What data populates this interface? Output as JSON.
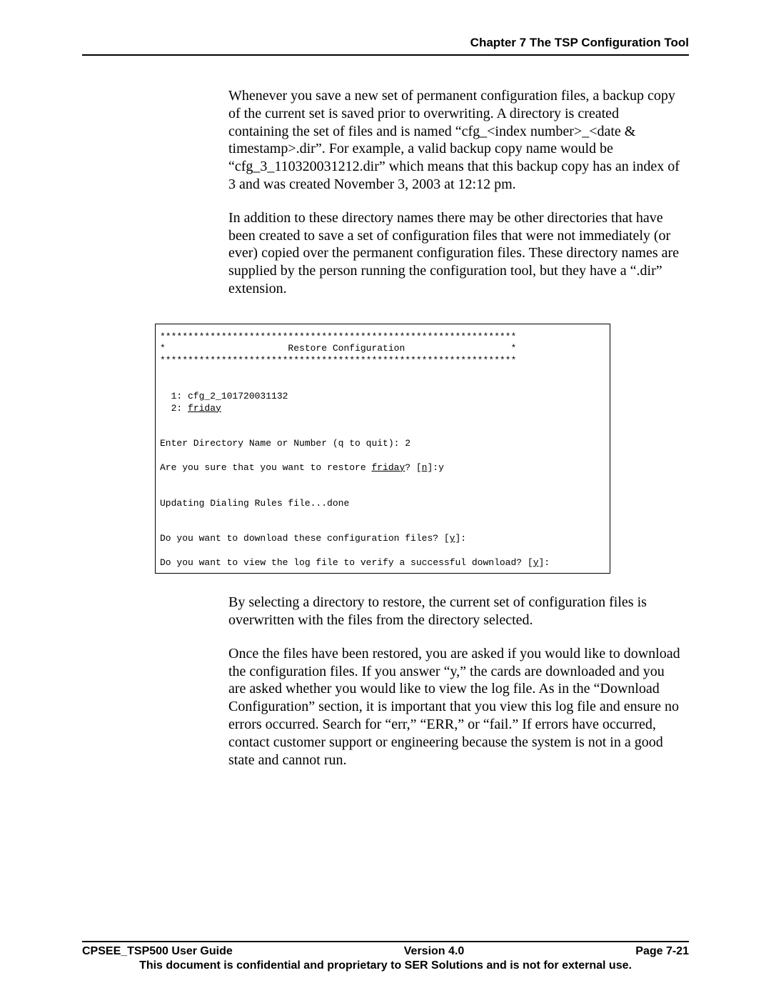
{
  "header": {
    "chapter_title": "Chapter 7 The TSP Configuration Tool"
  },
  "body": {
    "p1": "Whenever you save a new set of permanent configuration files, a backup copy of the current set is saved prior to overwriting.  A directory is created containing the set of files and is named “cfg_<index number>_<date & timestamp>.dir”. For example, a valid backup copy name would be “cfg_3_110320031212.dir” which means that this backup copy has an index of 3 and was created November 3, 2003 at 12:12 pm.",
    "p2": "In addition to these directory names there may be other directories that have been created to save a set of configuration files that were not immediately (or ever) copied over the permanent configuration files. These directory names are supplied by the person running the configuration tool, but they have a “.dir” extension.",
    "p3": "By selecting a directory to restore, the current set of configuration files is overwritten with the files from the directory selected.",
    "p4": "Once the files have been restored, you are asked if you would like to download the configuration files.  If you answer “y,” the cards are downloaded and you are asked whether you would like to view the log file.  As in the “Download Configuration” section, it is important that you view this log file and ensure no errors occurred.  Search for “err,” “ERR,” or “fail.” If errors have occurred, contact customer support or engineering because the system is not in a good state and cannot run."
  },
  "terminal": {
    "stars": "****************************************************************",
    "title_line": "*                      Restore Configuration                   *",
    "item1": "  1: cfg_2_101720031132",
    "item2_prefix": "  2: ",
    "item2_name": "friday",
    "prompt_dir": "Enter Directory Name or Number (q to quit): 2",
    "confirm_prefix": "Are you sure that you want to restore ",
    "confirm_mid": "? [",
    "confirm_n": "n",
    "confirm_suffix": "]:y",
    "updating": "Updating Dialing Rules file...done",
    "q_download_prefix": "Do you want to download these configuration files? [",
    "q_y": "y",
    "q_download_suffix": "]:",
    "q_view_prefix": "Do you want to view the log file to verify a successful download? [",
    "q_view_suffix": "]:"
  },
  "footer": {
    "left": "CPSEE_TSP500 User Guide",
    "center": "Version 4.0",
    "right": "Page 7-21",
    "note": "This document is confidential and proprietary to SER Solutions and is not for external use."
  }
}
